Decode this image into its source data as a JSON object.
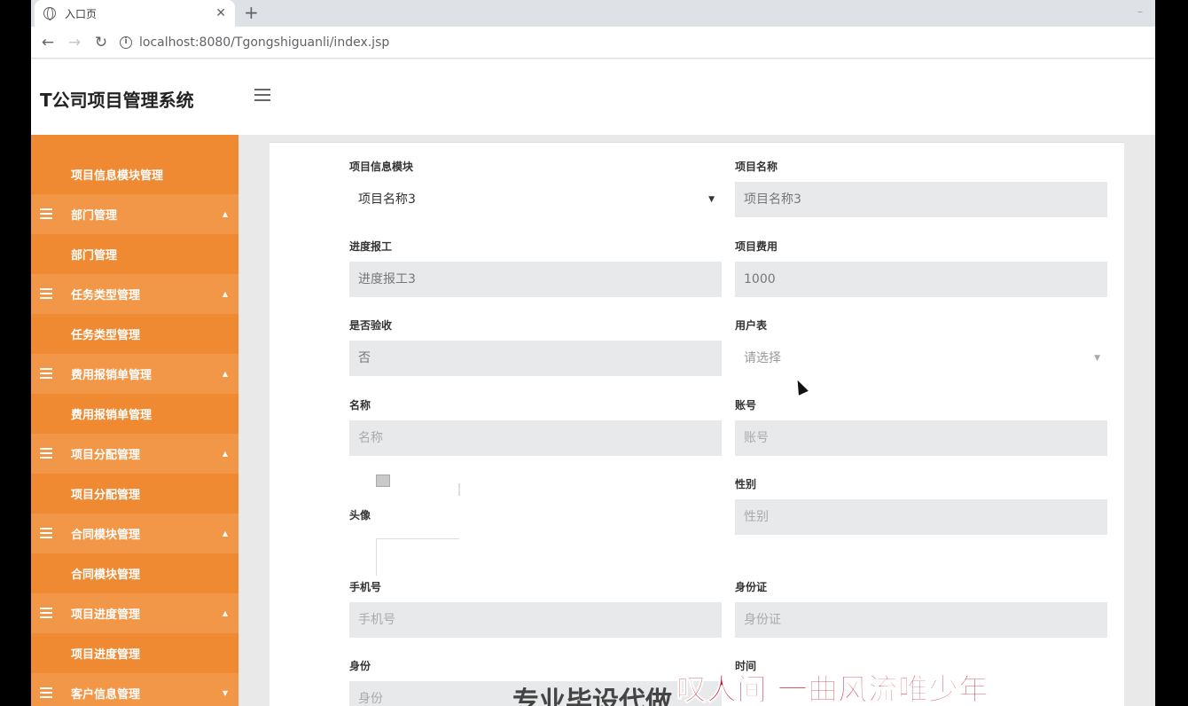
{
  "browser": {
    "tab_title": "入口页",
    "tab_close": "✕",
    "new_tab": "+",
    "url": "localhost:8080/Tgongshiguanli/index.jsp",
    "back": "←",
    "forward": "→",
    "reload": "↻",
    "info": "i"
  },
  "app": {
    "title": "T公司项目管理系统"
  },
  "sidebar": {
    "items": [
      {
        "type": "child",
        "label": "项目信息模块管理"
      },
      {
        "type": "parent",
        "label": "部门管理"
      },
      {
        "type": "child",
        "label": "部门管理"
      },
      {
        "type": "parent",
        "label": "任务类型管理"
      },
      {
        "type": "child",
        "label": "任务类型管理"
      },
      {
        "type": "parent",
        "label": "费用报销单管理"
      },
      {
        "type": "child",
        "label": "费用报销单管理"
      },
      {
        "type": "parent",
        "label": "项目分配管理"
      },
      {
        "type": "child",
        "label": "项目分配管理"
      },
      {
        "type": "parent",
        "label": "合同模块管理"
      },
      {
        "type": "child",
        "label": "合同模块管理"
      },
      {
        "type": "parent",
        "label": "项目进度管理"
      },
      {
        "type": "child",
        "label": "项目进度管理"
      },
      {
        "type": "parent",
        "label": "客户信息管理"
      }
    ]
  },
  "form": {
    "project_module": {
      "label": "项目信息模块",
      "value": "项目名称3"
    },
    "project_name": {
      "label": "项目名称",
      "value": "项目名称3"
    },
    "progress": {
      "label": "进度报工",
      "value": "进度报工3"
    },
    "project_cost": {
      "label": "项目费用",
      "value": "1000"
    },
    "accepted": {
      "label": "是否验收",
      "value": "否"
    },
    "user_table": {
      "label": "用户表",
      "value": "请选择"
    },
    "name": {
      "label": "名称",
      "placeholder": "名称"
    },
    "account": {
      "label": "账号",
      "placeholder": "账号"
    },
    "gender": {
      "label": "性别",
      "placeholder": "性别"
    },
    "avatar": {
      "label": "头像"
    },
    "phone": {
      "label": "手机号",
      "placeholder": "手机号"
    },
    "id_card": {
      "label": "身份证",
      "placeholder": "身份证"
    },
    "identity": {
      "label": "身份",
      "placeholder": "身份"
    },
    "time": {
      "label": "时间"
    }
  },
  "overlay": {
    "subtitle_gray": "专业毕设代做",
    "subtitle_red": "叹人间 一曲风流唯少年"
  }
}
